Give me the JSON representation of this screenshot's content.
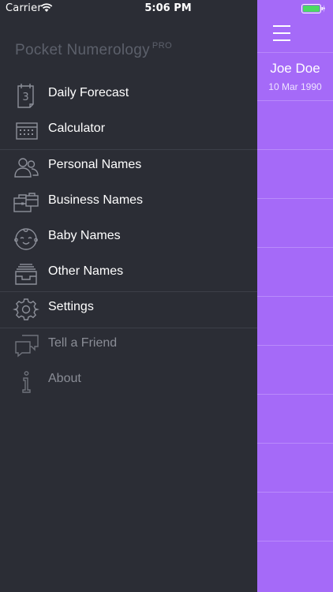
{
  "status_bar": {
    "carrier": "Carrier",
    "time": "5:06 PM"
  },
  "app": {
    "title": "Pocket Numerology",
    "badge": "PRO"
  },
  "menu": [
    {
      "label": "Daily Forecast",
      "icon": "calendar-icon",
      "calendar_day": "3"
    },
    {
      "label": "Calculator",
      "icon": "calculator-icon"
    },
    {
      "label": "Personal Names",
      "icon": "people-icon"
    },
    {
      "label": "Business Names",
      "icon": "briefcase-icon"
    },
    {
      "label": "Baby Names",
      "icon": "baby-face-icon"
    },
    {
      "label": "Other Names",
      "icon": "inbox-tray-icon"
    },
    {
      "label": "Settings",
      "icon": "gear-icon"
    },
    {
      "label": "Tell a Friend",
      "icon": "chat-bubbles-icon"
    },
    {
      "label": "About",
      "icon": "info-icon"
    }
  ],
  "profile": {
    "name": "Joe Doe",
    "date": "10 Mar 1990"
  },
  "colors": {
    "drawer_bg": "#2b2d35",
    "accent_purple": "#a56af8",
    "battery_green": "#4cd964"
  }
}
